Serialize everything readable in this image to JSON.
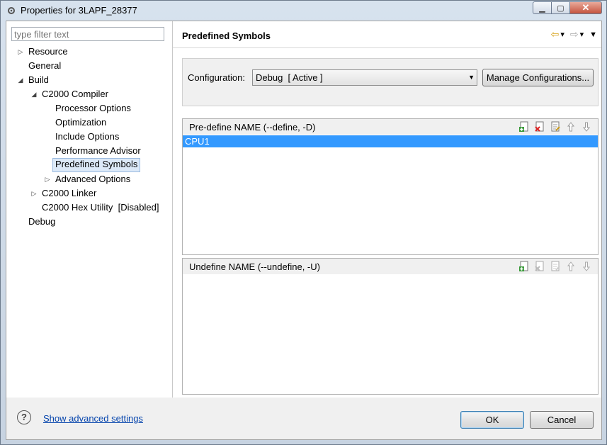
{
  "window": {
    "title": "Properties for 3LAPF_28377",
    "min_glyph": "▁",
    "max_glyph": "▢",
    "close_glyph": "✕"
  },
  "filter": {
    "placeholder": "type filter text"
  },
  "tree": [
    {
      "label": "Resource",
      "twisty": "▷"
    },
    {
      "label": "General",
      "twisty": ""
    },
    {
      "label": "Build",
      "twisty": "◢"
    },
    {
      "label": "C2000 Compiler",
      "twisty": "◢"
    },
    {
      "label": "Processor Options",
      "twisty": ""
    },
    {
      "label": "Optimization",
      "twisty": ""
    },
    {
      "label": "Include Options",
      "twisty": ""
    },
    {
      "label": "Performance Advisor",
      "twisty": ""
    },
    {
      "label": "Predefined Symbols",
      "twisty": ""
    },
    {
      "label": "Advanced Options",
      "twisty": "▷"
    },
    {
      "label": "C2000 Linker",
      "twisty": "▷"
    },
    {
      "label": "C2000 Hex Utility  [Disabled]",
      "twisty": ""
    },
    {
      "label": "Debug",
      "twisty": ""
    }
  ],
  "page": {
    "title": "Predefined Symbols",
    "nav_back": "⇦",
    "nav_forward": "⇨",
    "nav_dropdown": "▾",
    "view_menu": "▼"
  },
  "config": {
    "label": "Configuration:",
    "value": "Debug  [ Active ]",
    "arrow": "▼",
    "manage_button": "Manage Configurations..."
  },
  "predefine": {
    "title": "Pre-define NAME (--define, -D)",
    "items": [
      "CPU1"
    ]
  },
  "undefine": {
    "title": "Undefine NAME (--undefine, -U)",
    "items": []
  },
  "footer": {
    "help": "?",
    "advanced_link": "Show advanced settings",
    "ok": "OK",
    "cancel": "Cancel"
  },
  "colors": {
    "selection": "#3399ff",
    "tree_selection": "#dce9f8",
    "link": "#0645ad"
  }
}
